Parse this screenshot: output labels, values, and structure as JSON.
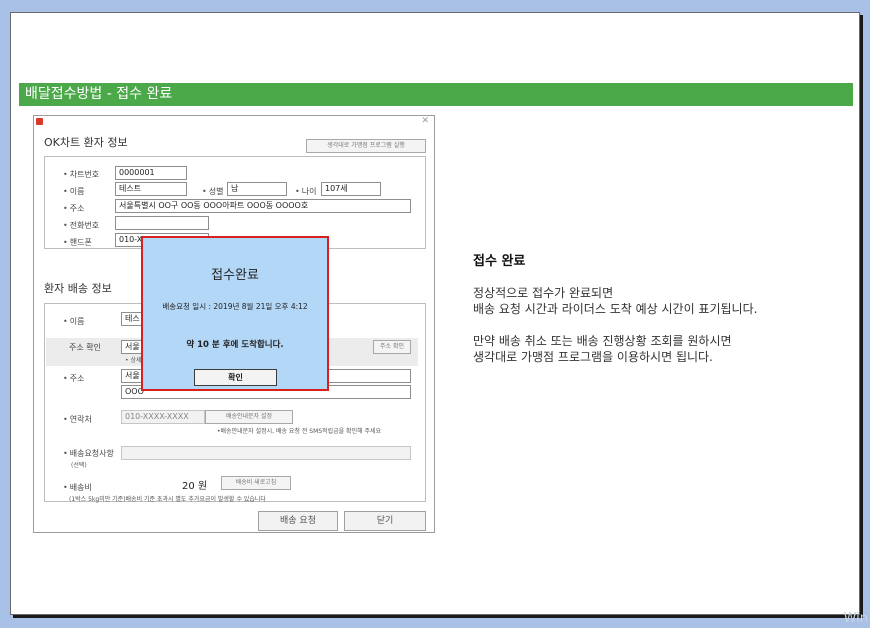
{
  "slide": {
    "banner_title": "배달접수방법 - 접수 완료"
  },
  "window": {
    "patient_section_title": "OK차트 환자 정보",
    "run_program_button": "생각대로 가맹점 프로그램 실행",
    "labels": {
      "chart_no": "차트번호",
      "name": "이름",
      "gender": "성별",
      "age": "나이",
      "address": "주소",
      "phone": "전화번호",
      "mobile": "핸드폰"
    },
    "values": {
      "chart_no": "0000001",
      "name": "테스트",
      "gender": "남",
      "age": "107세",
      "address": "서울특별시 OO구 OO동 OOO아파트 OOO동 OOOO호",
      "phone": "",
      "mobile": "010-X"
    },
    "delivery_section_title": "환자 배송 정보",
    "delivery_labels": {
      "name": "이름",
      "address_check": "주소 확인",
      "address_check_note": "• 상세",
      "address": "주소",
      "contact": "연락처",
      "request": "배송요청사항",
      "request_optional": "(선택)",
      "fee": "배송비"
    },
    "delivery_values": {
      "name": "테스",
      "address_check": "서울",
      "address_line1": "서울",
      "address_line2": "OOO",
      "contact": "010-XXXX-XXXX",
      "fee": "20 원"
    },
    "address_search_button": "주소 확인",
    "sms_button": "배송안내문자 설정",
    "sms_note": "•배송안내문자 설정시, 배송 요청 전 SMS적립금을 확인해 주세요",
    "fee_refresh_button": "배송비 새로고침",
    "fee_note": "(1박스 5kg미만 기준)배송비 기준 초과시 별도 추가요금이 발생할 수 있습니다",
    "request_delivery_button": "배송 요청",
    "close_button": "닫기"
  },
  "dialog": {
    "title": "접수완료",
    "time_text": "배송요청 일시 : 2019년 8월 21일 오후 4:12",
    "arrival_text": "약 10 분 후에 도착합니다.",
    "ok_button": "확인"
  },
  "description": {
    "heading": "접수 완료",
    "p1_line1": "정상적으로 접수가 완료되면",
    "p1_line2": "배송 요청 시간과 라이더스 도착 예상 시간이 표기됩니다.",
    "p2_line1": "만약 배송 취소 또는 배송 진행상황 조회를 원하시면",
    "p2_line2": "생각대로 가맹점 프로그램을 이용하시면 됩니다."
  },
  "watermark": "Win"
}
